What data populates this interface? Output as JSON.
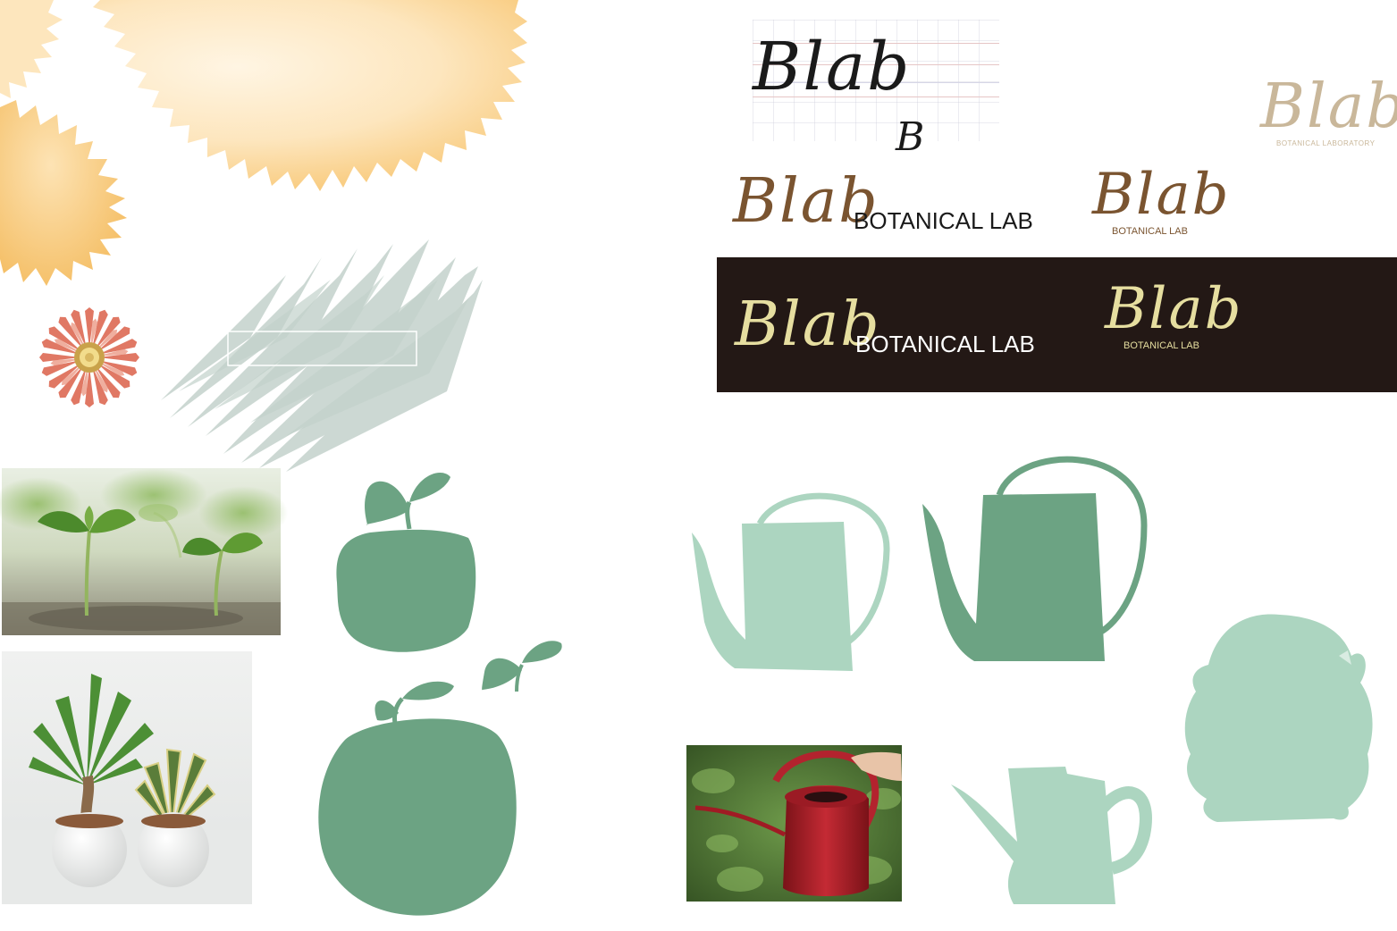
{
  "colors": {
    "yellow_light": "#fde9c8",
    "yellow_mid": "#f8d089",
    "yellow_deep": "#f5c26a",
    "coral": "#e07864",
    "grass": "#9bb3a8",
    "leaf_dark": "#6ca383",
    "leaf_light": "#acd5c0",
    "banner": "#231815",
    "brown": "#7a5430",
    "beige": "#c9b79a",
    "cream": "#e6dea0",
    "ink": "#1a1a1a",
    "red_can": "#b3232e"
  },
  "logos": {
    "sketch_wordmark": "Blab",
    "sketch_monogram": "B",
    "light_wordmark": "Blab",
    "light_tagline": "BOTANICAL LABORATORY",
    "brown_wordmark": "Blab",
    "brown_tagline": "BOTANICAL LAB",
    "brown_stack_wordmark": "Blab",
    "brown_stack_tagline": "BOTANICAL LAB",
    "banner_wordmark": "Blab",
    "banner_tagline": "BOTANICAL LAB",
    "banner_stack_wordmark": "Blab",
    "banner_stack_tagline": "BOTANICAL LAB"
  },
  "photos": [
    {
      "subject": "seedlings-sprouting"
    },
    {
      "subject": "potted-money-tree-and-snake-plant"
    },
    {
      "subject": "hand-holding-red-watering-can"
    }
  ],
  "shapes": [
    "yellow-splash",
    "coral-daisy",
    "grass-brush-swatch",
    "small-sprout-pot",
    "large-sprout-pot",
    "floating-sprout",
    "light-watering-can",
    "dark-watering-can",
    "small-watering-can",
    "green-bush-silhouette"
  ]
}
